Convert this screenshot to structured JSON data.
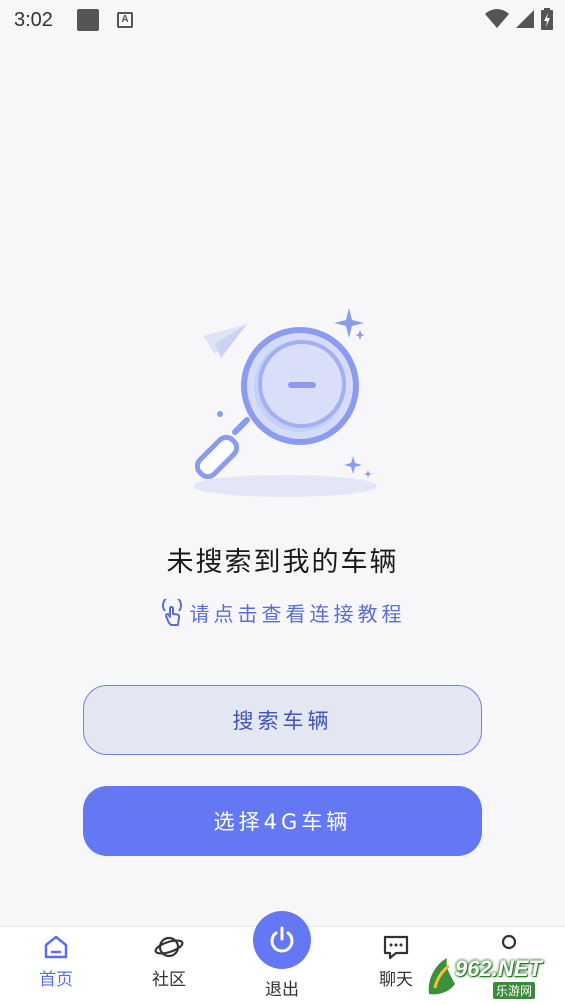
{
  "status_bar": {
    "time": "3:02",
    "icons": [
      "notification-square-icon",
      "keyboard-a-icon",
      "wifi-icon",
      "signal-icon",
      "battery-charging-icon"
    ]
  },
  "empty_state": {
    "illustration": "magnifier-search-empty-icon",
    "title": "未搜索到我的车辆",
    "tutorial_link": "请点击查看连接教程"
  },
  "buttons": {
    "search_vehicle": "搜索车辆",
    "select_4g_vehicle": "选择4G车辆"
  },
  "tabbar": {
    "home": "首页",
    "community": "社区",
    "exit": "退出",
    "chat": "聊天",
    "mine": ""
  },
  "watermark": {
    "text": "962.NET",
    "sub": "乐游网"
  },
  "colors": {
    "accent": "#6478f3",
    "accent_light_bg": "#e4e6f1",
    "link": "#5b6ed6",
    "background": "#f7f7f9"
  }
}
